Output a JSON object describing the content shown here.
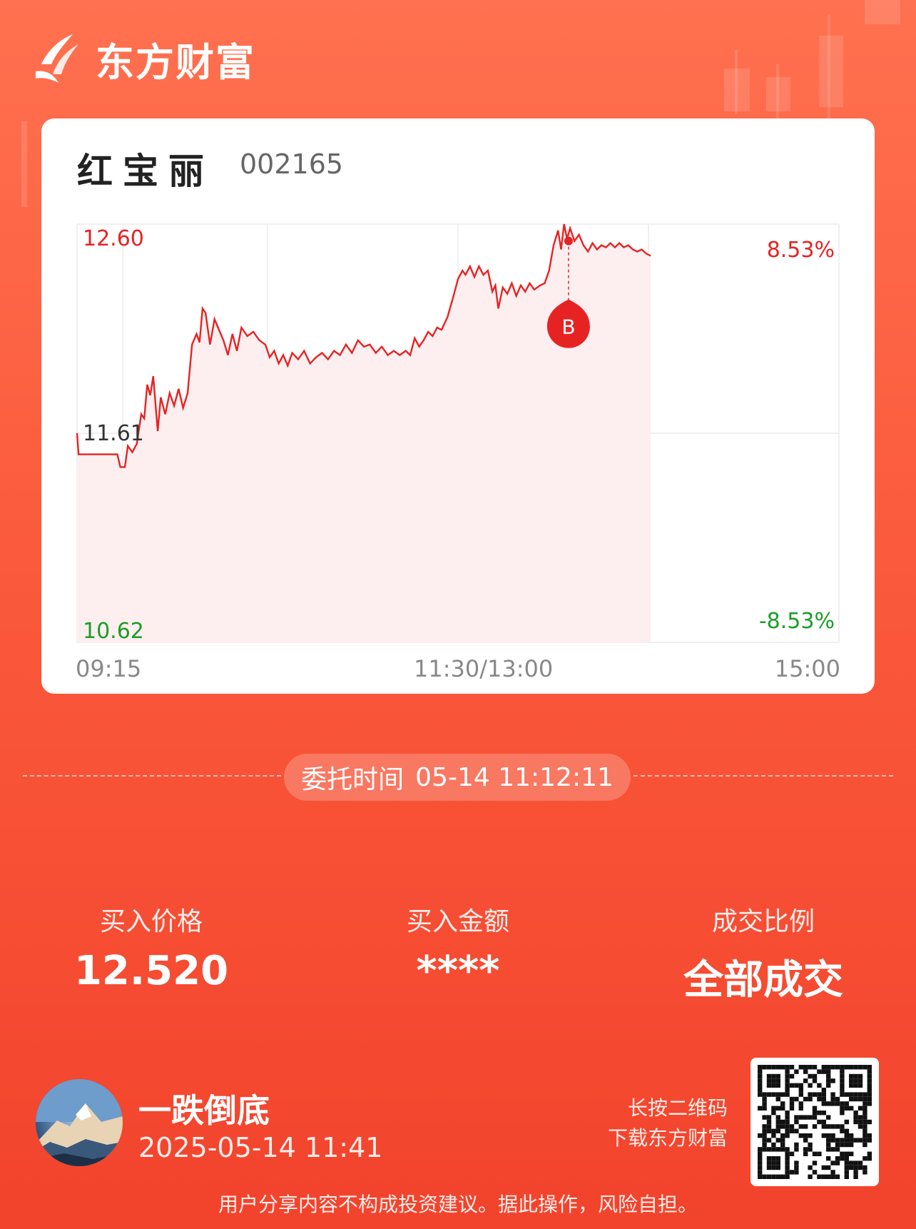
{
  "brand": {
    "name": "东方财富",
    "icon": "eastmoney-logo-icon"
  },
  "stock": {
    "name": "红宝丽",
    "code": "002165"
  },
  "chart_data": {
    "type": "line",
    "y_left_ticks": [
      "12.60",
      "11.61",
      "10.62"
    ],
    "y_right_ticks": [
      "8.53%",
      "-8.53%"
    ],
    "x_ticks": [
      "09:15",
      "11:30/13:00",
      "15:00"
    ],
    "ylim": [
      10.62,
      12.6
    ],
    "reference_price": 11.61,
    "session_minutes": 255,
    "series": [
      {
        "points": [
          [
            0,
            11.61
          ],
          [
            0.5,
            11.51
          ],
          [
            10,
            11.51
          ],
          [
            13.5,
            11.51
          ],
          [
            14.5,
            11.45
          ],
          [
            16,
            11.45
          ],
          [
            17,
            11.55
          ],
          [
            18.5,
            11.52
          ],
          [
            20,
            11.56
          ],
          [
            21.5,
            11.7
          ],
          [
            22.5,
            11.68
          ],
          [
            23.5,
            11.84
          ],
          [
            24.5,
            11.79
          ],
          [
            25.5,
            11.88
          ],
          [
            27,
            11.62
          ],
          [
            28,
            11.78
          ],
          [
            29.5,
            11.7
          ],
          [
            31,
            11.8
          ],
          [
            32.5,
            11.74
          ],
          [
            34,
            11.82
          ],
          [
            35.5,
            11.73
          ],
          [
            37,
            11.8
          ],
          [
            38.5,
            12.03
          ],
          [
            40,
            12.08
          ],
          [
            41,
            12.04
          ],
          [
            42,
            12.2
          ],
          [
            43,
            12.18
          ],
          [
            44.5,
            12.03
          ],
          [
            46,
            12.15
          ],
          [
            47.5,
            12.1
          ],
          [
            49,
            12.05
          ],
          [
            50.5,
            11.98
          ],
          [
            52,
            12.08
          ],
          [
            53.5,
            12.0
          ],
          [
            55,
            12.11
          ],
          [
            57,
            12.07
          ],
          [
            59,
            12.09
          ],
          [
            61,
            12.05
          ],
          [
            63,
            12.03
          ],
          [
            64.5,
            11.97
          ],
          [
            66,
            12.0
          ],
          [
            67.5,
            11.94
          ],
          [
            69,
            11.98
          ],
          [
            70.5,
            11.93
          ],
          [
            72,
            11.99
          ],
          [
            74,
            11.96
          ],
          [
            76,
            12.0
          ],
          [
            78,
            11.94
          ],
          [
            80,
            11.97
          ],
          [
            82,
            11.99
          ],
          [
            84,
            11.96
          ],
          [
            86,
            12.0
          ],
          [
            88,
            11.98
          ],
          [
            90,
            12.03
          ],
          [
            92,
            11.99
          ],
          [
            94,
            12.05
          ],
          [
            96,
            12.02
          ],
          [
            98,
            12.03
          ],
          [
            100,
            11.99
          ],
          [
            102,
            12.02
          ],
          [
            104,
            11.98
          ],
          [
            106,
            12.0
          ],
          [
            108,
            11.98
          ],
          [
            110,
            12.0
          ],
          [
            111.5,
            11.98
          ],
          [
            113,
            12.06
          ],
          [
            114.5,
            12.02
          ],
          [
            116,
            12.05
          ],
          [
            117.5,
            12.09
          ],
          [
            119,
            12.07
          ],
          [
            120.5,
            12.11
          ],
          [
            122,
            12.1
          ],
          [
            124,
            12.16
          ],
          [
            126,
            12.26
          ],
          [
            127.5,
            12.34
          ],
          [
            129,
            12.38
          ],
          [
            130,
            12.36
          ],
          [
            131.5,
            12.4
          ],
          [
            133,
            12.35
          ],
          [
            134.5,
            12.4
          ],
          [
            136,
            12.36
          ],
          [
            137.5,
            12.38
          ],
          [
            139,
            12.28
          ],
          [
            140,
            12.31
          ],
          [
            141,
            12.2
          ],
          [
            142.5,
            12.3
          ],
          [
            144,
            12.27
          ],
          [
            145.5,
            12.32
          ],
          [
            147,
            12.26
          ],
          [
            148.5,
            12.31
          ],
          [
            150,
            12.28
          ],
          [
            151.5,
            12.32
          ],
          [
            153,
            12.29
          ],
          [
            155,
            12.31
          ],
          [
            156.5,
            12.32
          ],
          [
            158,
            12.38
          ],
          [
            159.5,
            12.5
          ],
          [
            161,
            12.57
          ],
          [
            162,
            12.48
          ],
          [
            163,
            12.6
          ],
          [
            164,
            12.53
          ],
          [
            165,
            12.58
          ],
          [
            166.5,
            12.52
          ],
          [
            168,
            12.55
          ],
          [
            169.5,
            12.5
          ],
          [
            171,
            12.47
          ],
          [
            172.5,
            12.51
          ],
          [
            174,
            12.48
          ],
          [
            175.5,
            12.5
          ],
          [
            177,
            12.49
          ],
          [
            178.5,
            12.51
          ],
          [
            180,
            12.49
          ],
          [
            181.5,
            12.51
          ],
          [
            183,
            12.49
          ],
          [
            184.5,
            12.5
          ],
          [
            186,
            12.48
          ],
          [
            187.5,
            12.47
          ],
          [
            189,
            12.48
          ],
          [
            190.5,
            12.46
          ],
          [
            192,
            12.45
          ]
        ]
      }
    ],
    "marker": {
      "label": "B",
      "time_min": 164.5,
      "price": 12.52
    },
    "grid": true
  },
  "order": {
    "label": "委托时间",
    "time": "05-14 11:12:11"
  },
  "stats": [
    {
      "label": "买入价格",
      "value": "12.520"
    },
    {
      "label": "买入金额",
      "value": "****"
    },
    {
      "label": "成交比例",
      "value": "全部成交"
    }
  ],
  "user": {
    "name": "一跌倒底",
    "time": "2025-05-14 11:41",
    "avatar": "mountain-avatar"
  },
  "qr": {
    "hint_line1": "长按二维码",
    "hint_line2": "下载东方财富",
    "icon": "qr-code-icon"
  },
  "disclaimer": "用户分享内容不构成投资建议。据此操作，风险自担。",
  "colors": {
    "up": "#e62322",
    "down": "#1a9e23",
    "background_top": "#ff7150",
    "background_bottom": "#f2432c"
  }
}
